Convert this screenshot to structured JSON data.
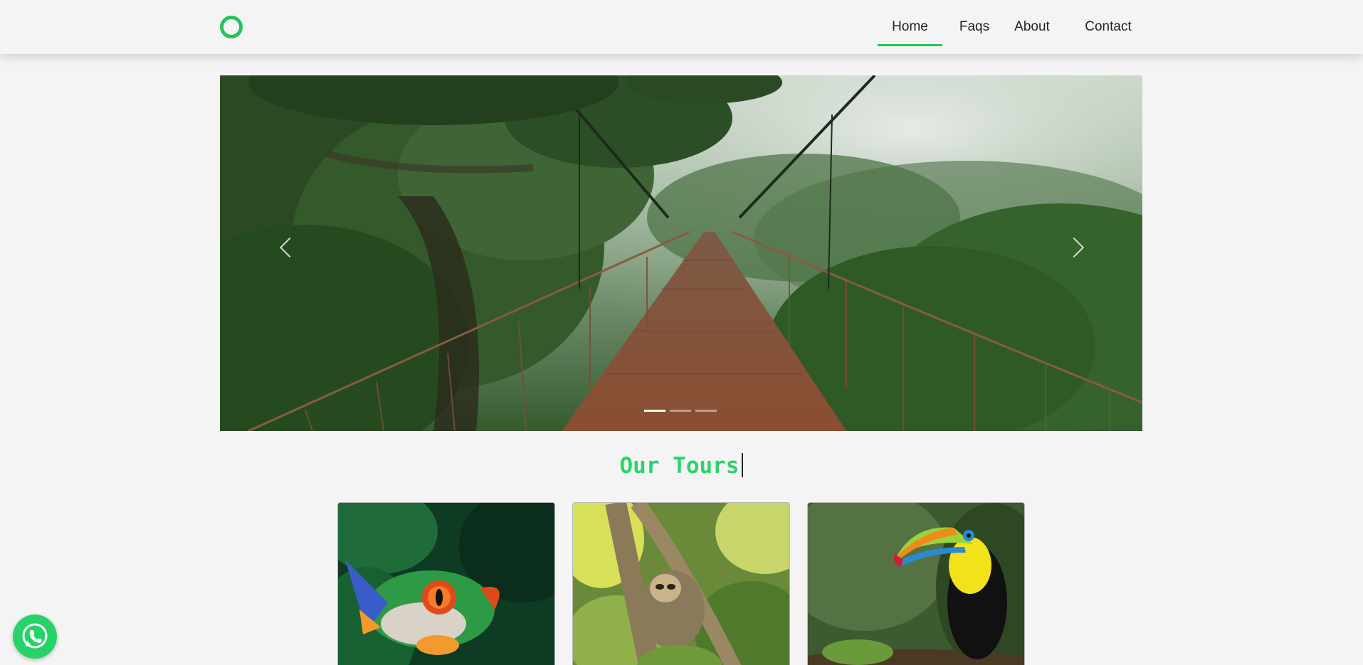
{
  "nav": {
    "items": [
      {
        "label": "Home",
        "active": true
      },
      {
        "label": "Faqs",
        "active": false
      },
      {
        "label": "About",
        "active": false
      },
      {
        "label": "Contact",
        "active": false
      }
    ]
  },
  "carousel": {
    "slide_count": 3,
    "active_slide": 1,
    "image": "suspension bridge in misty rainforest"
  },
  "tours": {
    "title": "Our Tours",
    "cards": [
      {
        "image": "red-eyed tree frog"
      },
      {
        "image": "sloth hanging in tree"
      },
      {
        "image": "keel-billed toucan"
      }
    ]
  },
  "colors": {
    "accent": "#25c55b",
    "title": "#2ad46a",
    "whatsapp": "#25d366",
    "background": "#f4f4f4"
  },
  "icons": {
    "logo": "ring-logo-icon",
    "prev": "chevron-left-icon",
    "next": "chevron-right-icon",
    "whatsapp": "whatsapp-icon"
  }
}
